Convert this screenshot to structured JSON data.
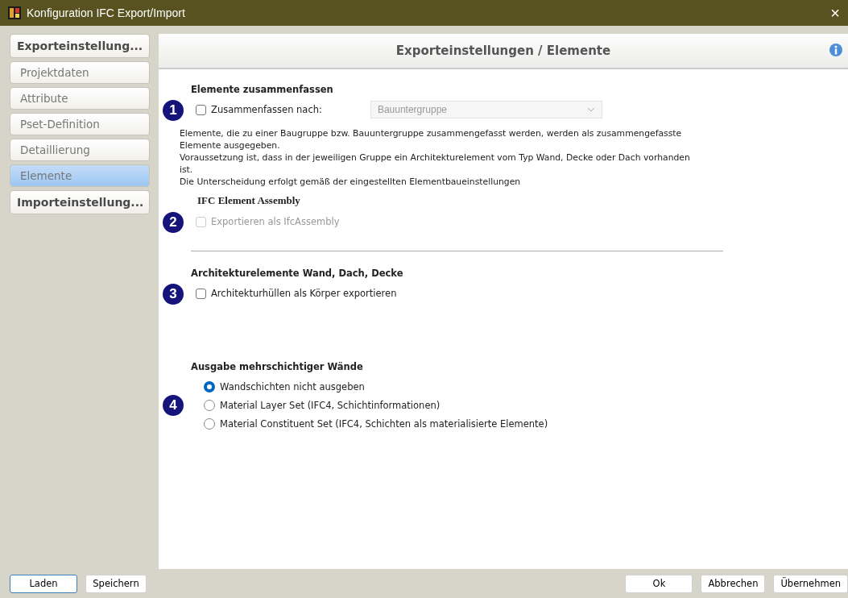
{
  "window": {
    "title": "Konfiguration IFC Export/Import",
    "close": "×"
  },
  "sidebar": {
    "items": [
      {
        "label": "Exporteinstellung...",
        "kind": "header",
        "selected": false
      },
      {
        "label": "Projektdaten",
        "kind": "item",
        "selected": false
      },
      {
        "label": "Attribute",
        "kind": "item",
        "selected": false
      },
      {
        "label": "Pset-Definition",
        "kind": "item",
        "selected": false
      },
      {
        "label": "Detaillierung",
        "kind": "item",
        "selected": false
      },
      {
        "label": "Elemente",
        "kind": "item",
        "selected": true
      },
      {
        "label": "Importeinstellung...",
        "kind": "header",
        "selected": false
      }
    ]
  },
  "panel": {
    "title": "Exporteinstellungen / Elemente",
    "sections": [
      {
        "badge": "1",
        "heading": "Elemente zusammenfassen",
        "kind": "sans",
        "checkbox": {
          "label": "Zusammenfassen nach:",
          "checked": false,
          "disabled": false
        },
        "dropdown": {
          "value": "Bauuntergruppe",
          "disabled": true
        },
        "description": [
          "Elemente, die zu einer Baugruppe bzw. Bauuntergruppe zusammengefasst werden, werden als zusammengefasste",
          "Elemente ausgegeben.",
          "Voraussetzung ist, dass in der jeweiligen Gruppe ein  Architekturelement vom Typ Wand, Decke oder Dach vorhanden",
          "ist.",
          "Die Unterscheidung erfolgt gemäß der eingestellten Elementbaueinstellungen"
        ]
      },
      {
        "badge": "2",
        "heading": "IFC Element Assembly",
        "kind": "serif",
        "checkbox": {
          "label": "Exportieren als IfcAssembly",
          "checked": false,
          "disabled": true
        },
        "divider_after": true
      },
      {
        "badge": "3",
        "heading": "Architekturelemente Wand, Dach, Decke",
        "kind": "sans",
        "checkbox": {
          "label": "Architekturhüllen als Körper exportieren",
          "checked": false,
          "disabled": false
        }
      },
      {
        "badge": "4",
        "heading": "Ausgabe mehrschichtiger Wände",
        "kind": "sans",
        "radios": [
          {
            "label": "Wandschichten nicht ausgeben",
            "selected": true
          },
          {
            "label": "Material Layer Set (IFC4, Schichtinformationen)",
            "selected": false
          },
          {
            "label": "Material Constituent Set (IFC4, Schichten als materialisierte Elemente)",
            "selected": false
          }
        ]
      }
    ]
  },
  "footer": {
    "left": [
      {
        "label": "Laden",
        "focused": true
      },
      {
        "label": "Speichern",
        "focused": false
      }
    ],
    "right": [
      {
        "label": "Ok",
        "focused": false
      },
      {
        "label": "Abbrechen",
        "focused": false
      },
      {
        "label": "Übernehmen",
        "focused": false
      }
    ]
  }
}
